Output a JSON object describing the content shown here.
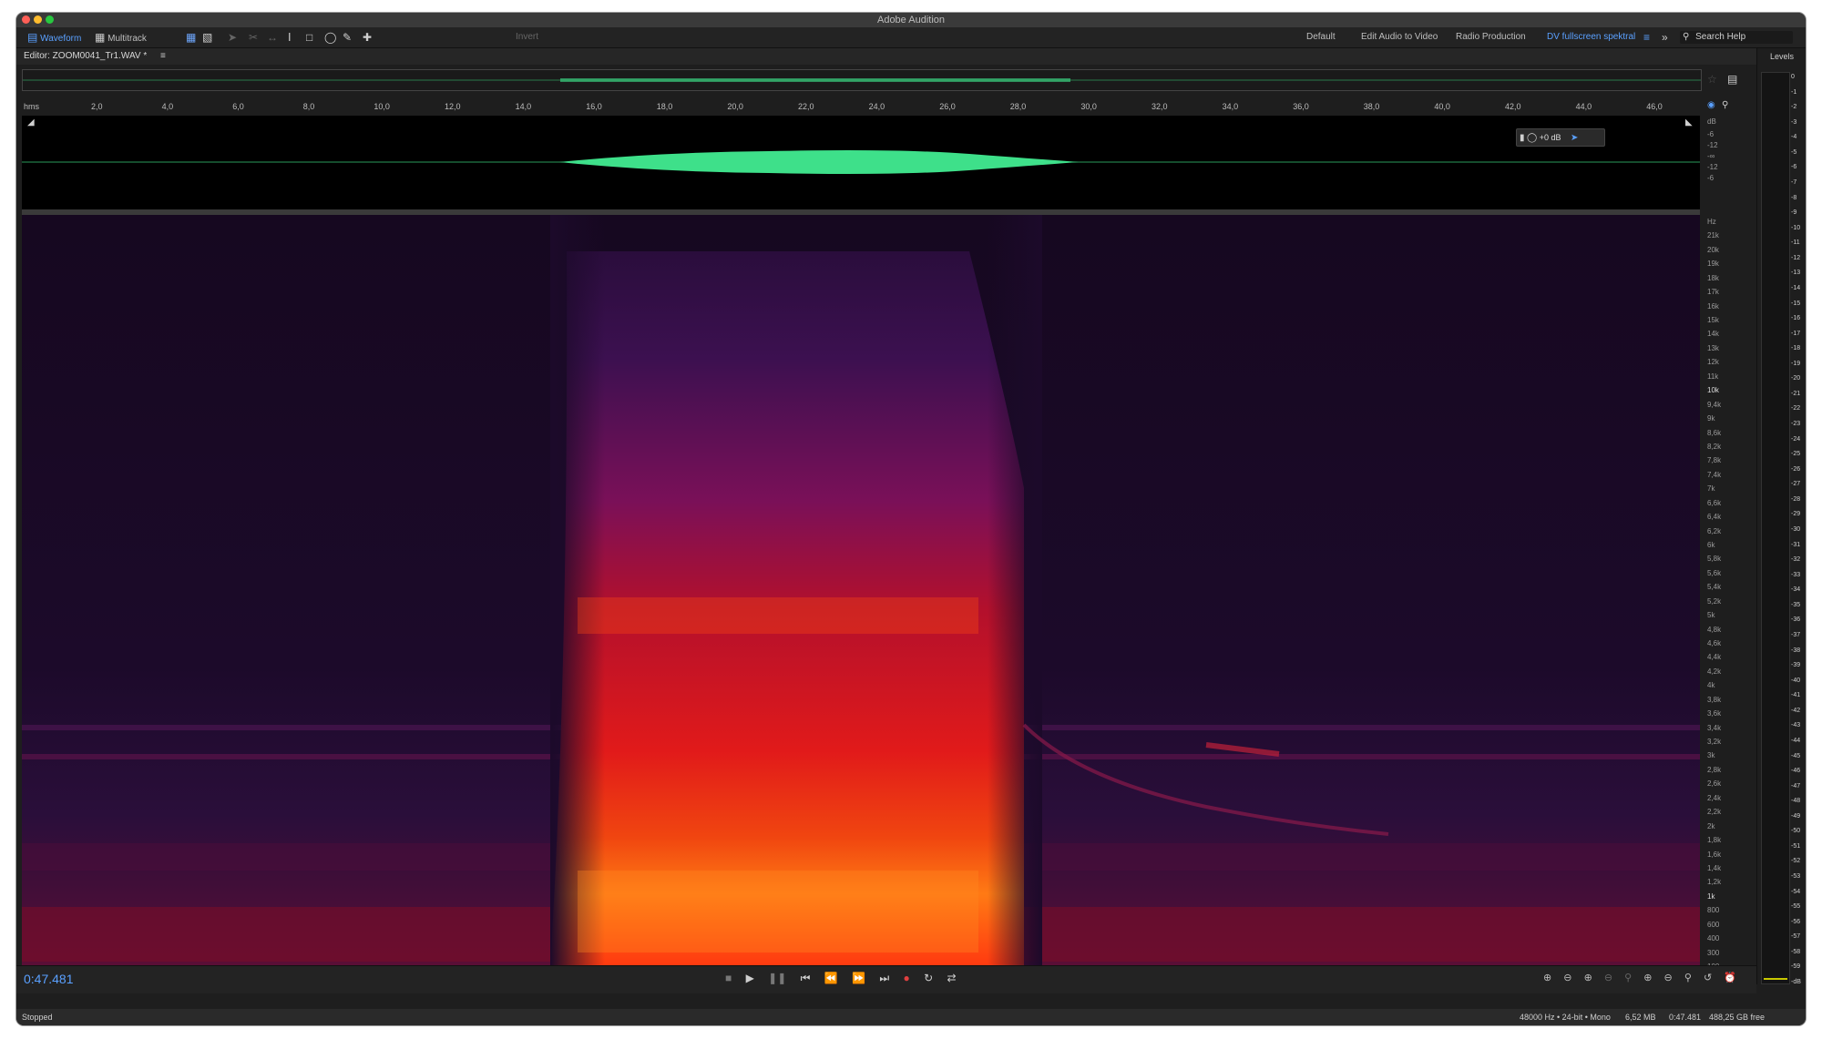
{
  "app": {
    "title": "Adobe Audition"
  },
  "toolbar": {
    "waveform_label": "Waveform",
    "multitrack_label": "Multitrack",
    "invert_label": "Invert",
    "workspaces": [
      "Default",
      "Edit Audio to Video",
      "Radio Production",
      "DV fullscreen spektral"
    ],
    "search_placeholder": "Search Help"
  },
  "editor": {
    "tab_label": "Editor: ZOOM0041_Tr1.WAV *"
  },
  "ruler": {
    "unit": "hms",
    "ticks": [
      "2,0",
      "4,0",
      "6,0",
      "8,0",
      "10,0",
      "12,0",
      "14,0",
      "16,0",
      "18,0",
      "20,0",
      "22,0",
      "24,0",
      "26,0",
      "28,0",
      "30,0",
      "32,0",
      "34,0",
      "36,0",
      "38,0",
      "40,0",
      "42,0",
      "44,0",
      "46,0"
    ]
  },
  "waveform": {
    "db_labels": [
      "dB",
      "-6",
      "-12",
      "-∞",
      "-12",
      "-6"
    ],
    "volume_label": "+0 dB",
    "color": "#3ee08a"
  },
  "spectral": {
    "hz_labels": [
      "Hz",
      "21k",
      "20k",
      "19k",
      "18k",
      "17k",
      "16k",
      "15k",
      "14k",
      "13k",
      "12k",
      "11k",
      "10k",
      "9,4k",
      "9k",
      "8,6k",
      "8,2k",
      "7,8k",
      "7,4k",
      "7k",
      "6,6k",
      "6,4k",
      "6,2k",
      "6k",
      "5,8k",
      "5,6k",
      "5,4k",
      "5,2k",
      "5k",
      "4,8k",
      "4,6k",
      "4,4k",
      "4,2k",
      "4k",
      "3,8k",
      "3,6k",
      "3,4k",
      "3,2k",
      "3k",
      "2,8k",
      "2,6k",
      "2,4k",
      "2,2k",
      "2k",
      "1,8k",
      "1,6k",
      "1,4k",
      "1,2k",
      "1k",
      "800",
      "600",
      "400",
      "300",
      "100"
    ]
  },
  "levels": {
    "title": "Levels",
    "db_ticks": [
      "0",
      "-1",
      "-2",
      "-3",
      "-4",
      "-5",
      "-6",
      "-7",
      "-8",
      "-9",
      "-10",
      "-11",
      "-12",
      "-13",
      "-14",
      "-15",
      "-16",
      "-17",
      "-18",
      "-19",
      "-20",
      "-21",
      "-22",
      "-23",
      "-24",
      "-25",
      "-26",
      "-27",
      "-28",
      "-29",
      "-30",
      "-31",
      "-32",
      "-33",
      "-34",
      "-35",
      "-36",
      "-37",
      "-38",
      "-39",
      "-40",
      "-41",
      "-42",
      "-43",
      "-44",
      "-45",
      "-46",
      "-47",
      "-48",
      "-49",
      "-50",
      "-51",
      "-52",
      "-53",
      "-54",
      "-55",
      "-56",
      "-57",
      "-58",
      "-59",
      "-dB"
    ]
  },
  "transport": {
    "time": "0:47.481"
  },
  "status": {
    "state": "Stopped",
    "format": "48000 Hz • 24-bit • Mono",
    "size": "6,52 MB",
    "duration": "0:47.481",
    "free": "488,25 GB free"
  }
}
